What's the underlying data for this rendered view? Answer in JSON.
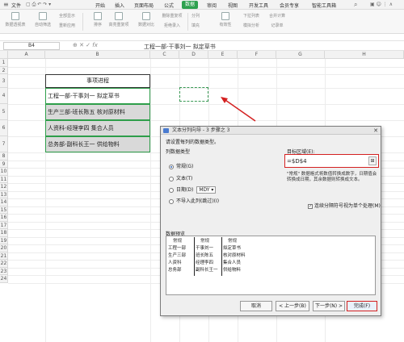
{
  "menubar": {
    "file_label": "文件",
    "items": [
      "开始",
      "插入",
      "页面布局",
      "公式",
      "数据",
      "审阅",
      "视图",
      "开发工具",
      "会员专享",
      "智能工具箱"
    ],
    "active_index": 4,
    "active_color": "#2ea14f"
  },
  "ribbon": {
    "buttons": [
      "数据透视表",
      "自动筛选",
      "全部显示",
      "重新应用",
      "排序",
      "高亮重复项",
      "数据对比",
      "删除重复项",
      "拒绝录入",
      "分列",
      "填充",
      "有效性",
      "下拉列表",
      "合并计算",
      "模拟分析",
      "记录单"
    ]
  },
  "formulabar": {
    "cell_ref": "B4",
    "fx_label": "fx",
    "content": "工程一部-干事刘一  拟定草书"
  },
  "grid": {
    "columns": [
      "A",
      "B",
      "C",
      "D",
      "E",
      "F",
      "G",
      "H"
    ],
    "rows": [
      "1",
      "2",
      "3",
      "4",
      "5",
      "6",
      "7",
      "8",
      "9",
      "10",
      "11",
      "12",
      "13",
      "14",
      "15",
      "16",
      "17",
      "18",
      "19",
      "20",
      "21",
      "22",
      "23",
      "24"
    ],
    "title": "事项进程",
    "cells": [
      "工程一部-干事刘一  拟定草书",
      "生产三部-班长陈五  核对原材料",
      "人资科-经理李四  集合人员",
      "总务部-副科长王一  供给物料"
    ]
  },
  "dialog": {
    "title": "文本分列向导 - 3 步骤之 3",
    "close": "✕",
    "description": "请设置每列的数据类型。",
    "type_group": "列数据类型",
    "options": [
      "常规(G)",
      "文本(T)",
      "日期(D)",
      "不导入此列(跳过)(I)"
    ],
    "selected_option": 0,
    "date_format": "MDY",
    "target_label": "目标区域(E):",
    "target_value": "=$D$4",
    "note": "\"常规\" 数据格式将数值转换成数字，日期值会转换成日期，其余数据则转换成文本。",
    "checkbox_label": "连续分隔符号视为单个处理(M)",
    "checkbox_checked": true,
    "preview_label": "数据预览",
    "preview_headers": [
      "常规",
      "常规",
      "常规"
    ],
    "preview_rows": [
      [
        "工程一部",
        "干事刘一",
        "拟定草书"
      ],
      [
        "生产三部",
        "班长陈五",
        "核对原材料"
      ],
      [
        "人资科",
        "经理李四",
        "集合人员"
      ],
      [
        "总务部",
        "副科长王一",
        "供给物料"
      ]
    ],
    "buttons": {
      "cancel": "取消",
      "back": "< 上一步(B)",
      "next": "下一步(N) >",
      "finish": "完成(F)"
    }
  },
  "annotation_color": "#d42020"
}
